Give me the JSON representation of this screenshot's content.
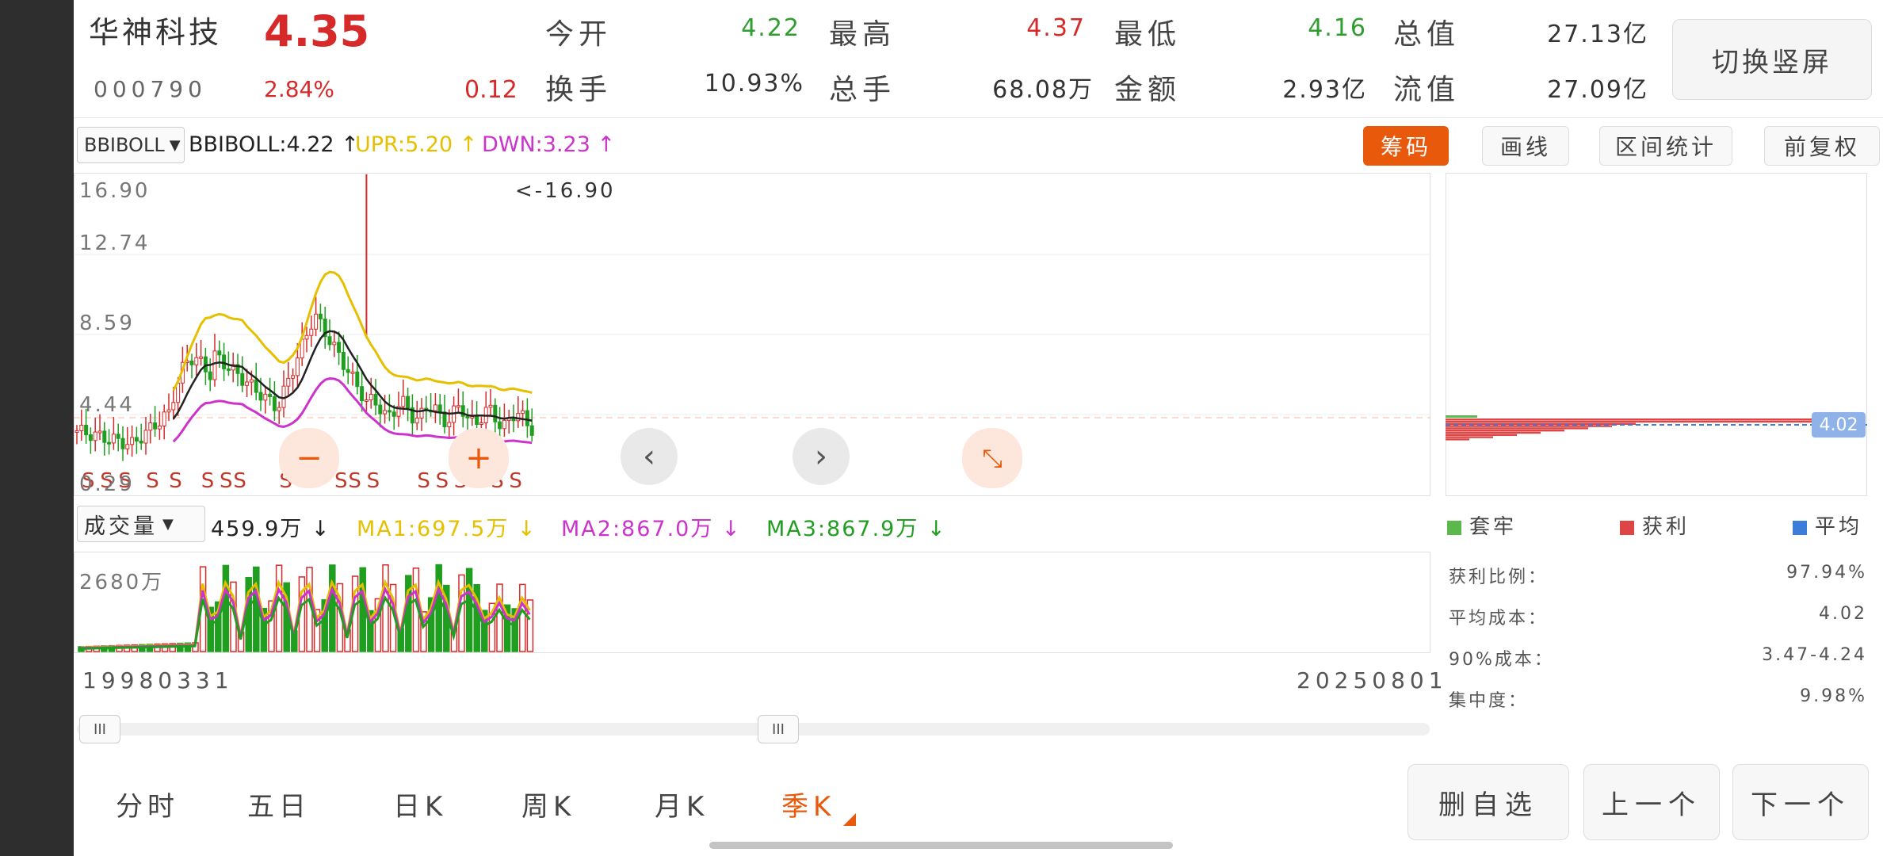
{
  "header": {
    "stock_name": "华神科技",
    "price": "4.35",
    "code": "000790",
    "change_pct": "2.84%",
    "change_amt": "0.12",
    "open_label": "今开",
    "open_value": "4.22",
    "high_label": "最高",
    "high_value": "4.37",
    "low_label": "最低",
    "low_value": "4.16",
    "total_mv_label": "总值",
    "total_mv_value": "27.13亿",
    "turnover_label": "换手",
    "turnover_value": "10.93%",
    "volume_label": "总手",
    "volume_value": "68.08万",
    "amount_label": "金额",
    "amount_value": "2.93亿",
    "float_mv_label": "流值",
    "float_mv_value": "27.09亿",
    "switch_button": "切换竖屏"
  },
  "indicator": {
    "select_value": "BBIBOLL",
    "bbiboll": "BBIBOLL:4.22 ↑",
    "upr": "UPR:5.20 ↑",
    "dwn": "DWN:3.23 ↑",
    "colors": {
      "bbiboll": "#222222",
      "upr": "#e6c000",
      "dwn": "#cc33cc"
    }
  },
  "tools": {
    "chips": "筹码",
    "draw": "画线",
    "interval": "区间统计",
    "adjust": "前复权"
  },
  "kline": {
    "y_labels": [
      "16.90",
      "12.74",
      "8.59",
      "4.44",
      "0.29"
    ],
    "peak_label": "<-16.90",
    "s_marker": "S",
    "dates": {
      "start": "19980331",
      "end": "20250801"
    }
  },
  "volume": {
    "select_value": "成交量",
    "vol": "459.9万 ↓",
    "ma1": "MA1:697.5万 ↓",
    "ma2": "MA2:867.0万 ↓",
    "ma3": "MA3:867.9万 ↓",
    "y_label": "2680万"
  },
  "chips_panel": {
    "avg_tag": "4.02",
    "legend": {
      "trapped": "套牢",
      "profit": "获利",
      "average": "平均"
    },
    "stats": [
      {
        "label": "获利比例：",
        "value": "97.94%"
      },
      {
        "label": "平均成本：",
        "value": "4.02"
      },
      {
        "label": "90%成本：",
        "value": "3.47-4.24"
      },
      {
        "label": "集中度：",
        "value": "9.98%"
      }
    ]
  },
  "periods": [
    "分时",
    "五日",
    "日K",
    "周K",
    "月K",
    "季K"
  ],
  "active_period": "季K",
  "bottom_buttons": {
    "delete": "删自选",
    "prev": "上一个",
    "next": "下一个"
  },
  "slider_handle_glyph": "III",
  "colors": {
    "up": "#d62a2a",
    "down": "#1f9e1f",
    "accent": "#e8590c"
  }
}
